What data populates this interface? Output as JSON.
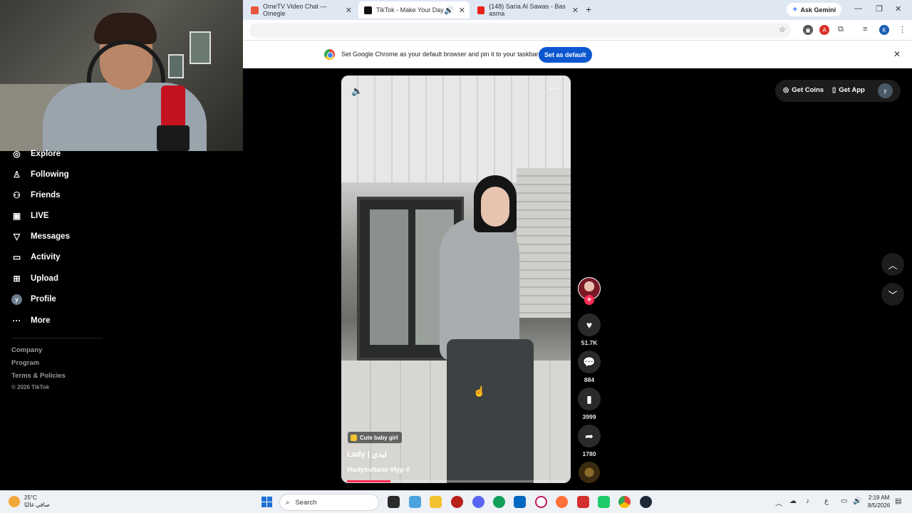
{
  "browser": {
    "tabs": [
      {
        "title": "OmeTV Video Chat — Omegle",
        "active": false
      },
      {
        "title": "TikTok - Make Your Day",
        "active": true
      },
      {
        "title": "(148) Saria Al Sawas - Bas asma",
        "active": false
      }
    ],
    "gemini_label": "Ask Gemini",
    "profile_initial": "K",
    "infobar": {
      "message": "Set Google Chrome as your default browser and pin it to your taskbar",
      "button": "Set as default"
    }
  },
  "sidebar": {
    "items": [
      {
        "label": "Explore",
        "icon": "compass-icon"
      },
      {
        "label": "Following",
        "icon": "person-icon"
      },
      {
        "label": "Friends",
        "icon": "friends-icon"
      },
      {
        "label": "LIVE",
        "icon": "live-icon"
      },
      {
        "label": "Messages",
        "icon": "send-icon"
      },
      {
        "label": "Activity",
        "icon": "activity-icon"
      },
      {
        "label": "Upload",
        "icon": "upload-icon"
      },
      {
        "label": "Profile",
        "icon": "avatar",
        "initial": "y"
      },
      {
        "label": "More",
        "icon": "more-icon"
      }
    ],
    "footer": [
      "Company",
      "Program",
      "Terms & Policies"
    ],
    "copyright": "© 2026 TikTok"
  },
  "video": {
    "tag": "Cute baby girl",
    "title": "Lady | ليدي",
    "hashtags": "#ladysultane #fyp #",
    "progress": 0.2
  },
  "actions": {
    "likes": "51.7K",
    "comments": "884",
    "saves": "3999",
    "shares": "1780"
  },
  "topright": {
    "coins": "Get Coins",
    "app": "Get App",
    "avatar_initial": "y"
  },
  "taskbar": {
    "temperature": "25°C",
    "weather": "صافي غالبًا",
    "search_placeholder": "Search",
    "time": "2:19 AM",
    "date": "8/5/2026",
    "lang": "ع"
  },
  "colors": {
    "accent": "#fe2c55",
    "chrome_blue": "#0b57d0"
  }
}
